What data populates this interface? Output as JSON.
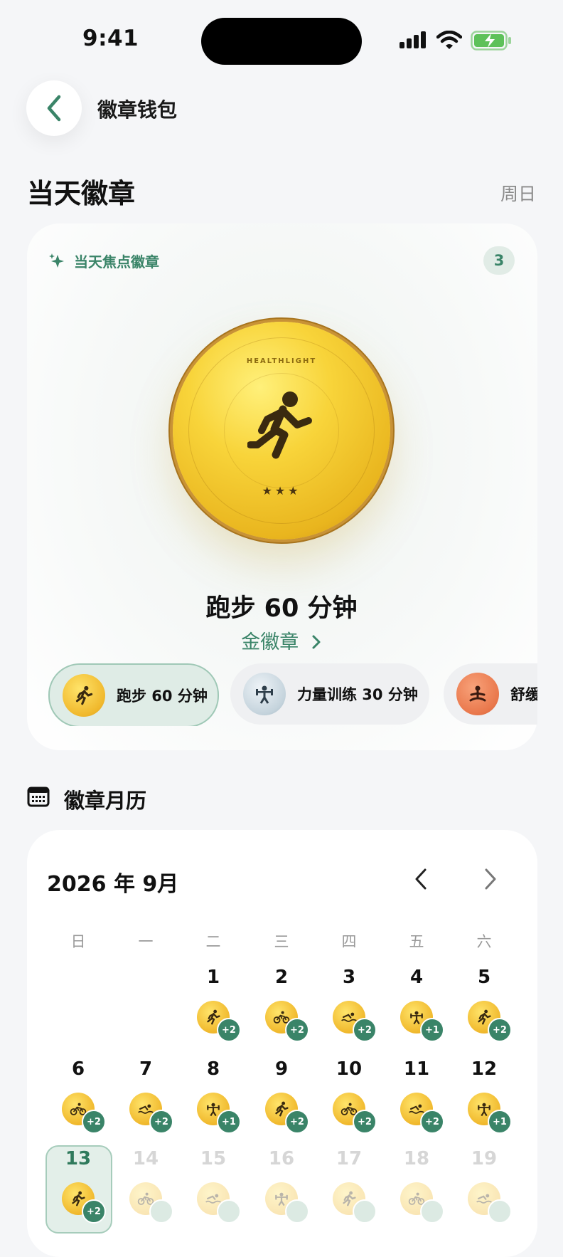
{
  "status_bar": {
    "time": "9:41"
  },
  "nav": {
    "title": "徽章钱包"
  },
  "section": {
    "title": "当天徽章",
    "weekday": "周日"
  },
  "focus": {
    "label": "当天焦点徽章",
    "count": "3",
    "medal_brand": "HEALTHLIGHT",
    "medal_stars": "★★★",
    "badge_name": "跑步 60 分钟",
    "tier_link": "金徽章"
  },
  "chips": [
    {
      "label": "跑步 60 分钟",
      "icon": "runner-icon",
      "color": "#f2bf2c"
    },
    {
      "label": "力量训练 30 分钟",
      "icon": "weightlifting-icon",
      "color": "#c9d6de"
    },
    {
      "label": "舒缓",
      "icon": "meditation-icon",
      "color": "#e9774b"
    }
  ],
  "calendar": {
    "title": "徽章月历",
    "month": "2026 年 9月",
    "weekdays": [
      "日",
      "一",
      "二",
      "三",
      "四",
      "五",
      "六"
    ],
    "weeks": [
      [
        {
          "day": "",
          "icon": ""
        },
        {
          "day": "",
          "icon": ""
        },
        {
          "day": "1",
          "icon": "runner",
          "extra": "+2"
        },
        {
          "day": "2",
          "icon": "cycling",
          "extra": "+2"
        },
        {
          "day": "3",
          "icon": "swimming",
          "extra": "+2"
        },
        {
          "day": "4",
          "icon": "strength",
          "extra": "+1"
        },
        {
          "day": "5",
          "icon": "runner",
          "extra": "+2"
        }
      ],
      [
        {
          "day": "6",
          "icon": "cycling",
          "extra": "+2"
        },
        {
          "day": "7",
          "icon": "swimming",
          "extra": "+2"
        },
        {
          "day": "8",
          "icon": "strength",
          "extra": "+1"
        },
        {
          "day": "9",
          "icon": "runner",
          "extra": "+2"
        },
        {
          "day": "10",
          "icon": "cycling",
          "extra": "+2"
        },
        {
          "day": "11",
          "icon": "swimming",
          "extra": "+2"
        },
        {
          "day": "12",
          "icon": "strength",
          "extra": "+1"
        }
      ],
      [
        {
          "day": "13",
          "icon": "runner",
          "extra": "+2",
          "today": true
        },
        {
          "day": "14",
          "icon": "cycling",
          "future": true
        },
        {
          "day": "15",
          "icon": "swimming",
          "future": true
        },
        {
          "day": "16",
          "icon": "strength",
          "future": true
        },
        {
          "day": "17",
          "icon": "runner",
          "future": true
        },
        {
          "day": "18",
          "icon": "cycling",
          "future": true
        },
        {
          "day": "19",
          "icon": "swimming",
          "future": true
        }
      ]
    ]
  }
}
